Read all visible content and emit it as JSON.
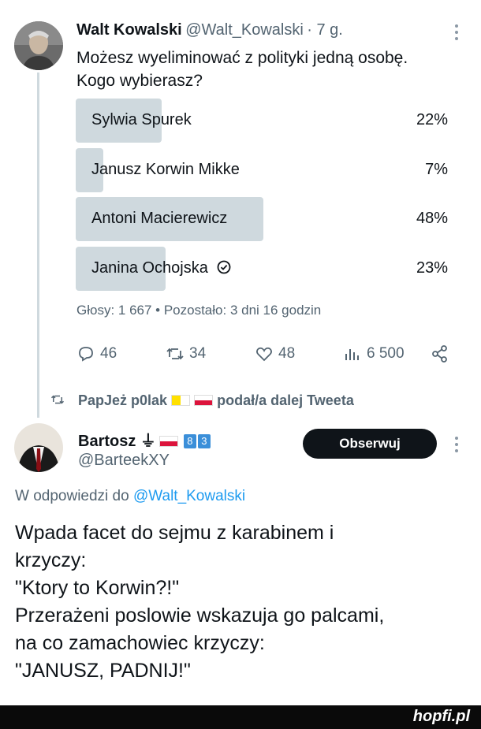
{
  "tweet": {
    "author_name": "Walt Kowalski",
    "handle": "@Walt_Kowalski",
    "time": "· 7 g.",
    "text_line1": "Możesz wyeliminować z polityki jedną osobę.",
    "text_line2": "Kogo wybierasz?",
    "poll": {
      "options": [
        {
          "label": "Sylwia Spurek",
          "percent_text": "22%",
          "percent": 22
        },
        {
          "label": "Janusz Korwin Mikke",
          "percent_text": "7%",
          "percent": 7
        },
        {
          "label": "Antoni Macierewicz",
          "percent_text": "48%",
          "percent": 48
        },
        {
          "label": "Janina Ochojska",
          "percent_text": "23%",
          "percent": 23
        }
      ],
      "meta": "Głosy: 1 667 • Pozostało: 3 dni 16 godzin"
    },
    "actions": {
      "replies": "46",
      "retweets": "34",
      "likes": "48",
      "views": "6 500"
    }
  },
  "retweet_note": {
    "user": "PapJeż p0lak",
    "suffix": "podał/a dalej Tweeta"
  },
  "reply": {
    "author_name": "Bartosz ⏚",
    "badge_digits": [
      "8",
      "3"
    ],
    "handle": "@BarteekXY",
    "follow_label": "Obserwuj",
    "reply_to_prefix": "W odpowiedzi do",
    "reply_to_handle": "@Walt_Kowalski",
    "lines": [
      "Wpada facet do sejmu z karabinem i",
      "krzyczy:",
      "\"Ktory to Korwin?!\"",
      "Przerażeni poslowie wskazuja go palcami,",
      "na co zamachowiec krzyczy:",
      "\"JANUSZ, PADNIJ!\""
    ]
  },
  "watermark": "hopfi.pl",
  "colors": {
    "poll_bar": "#cfd9de",
    "link": "#1d9bf0",
    "muted": "#536471",
    "follow_bg": "#0f1419"
  }
}
